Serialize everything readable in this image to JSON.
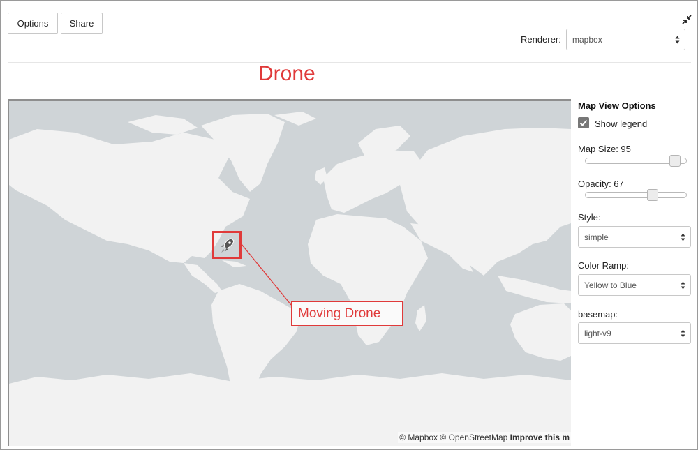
{
  "toolbar": {
    "options_label": "Options",
    "share_label": "Share"
  },
  "renderer": {
    "label": "Renderer:",
    "value": "mapbox"
  },
  "title": "Drone",
  "map": {
    "attribution_mapbox": "© Mapbox",
    "attribution_osm": "© OpenStreetMap",
    "attribution_improve": "Improve this m",
    "marker_icon": "rocket-icon",
    "callout_label": "Moving Drone"
  },
  "panel": {
    "title": "Map View Options",
    "show_legend": {
      "label": "Show legend",
      "checked": true
    },
    "map_size": {
      "label": "Map Size: 95",
      "value": 95
    },
    "opacity": {
      "label": "Opacity: 67",
      "value": 67
    },
    "style": {
      "label": "Style:",
      "value": "simple"
    },
    "color_ramp": {
      "label": "Color Ramp:",
      "value": "Yellow to Blue"
    },
    "basemap": {
      "label": "basemap:",
      "value": "light-v9"
    }
  },
  "colors": {
    "accent": "#e03a3a",
    "water": "#cfd4d7",
    "land": "#f2f2f2"
  }
}
